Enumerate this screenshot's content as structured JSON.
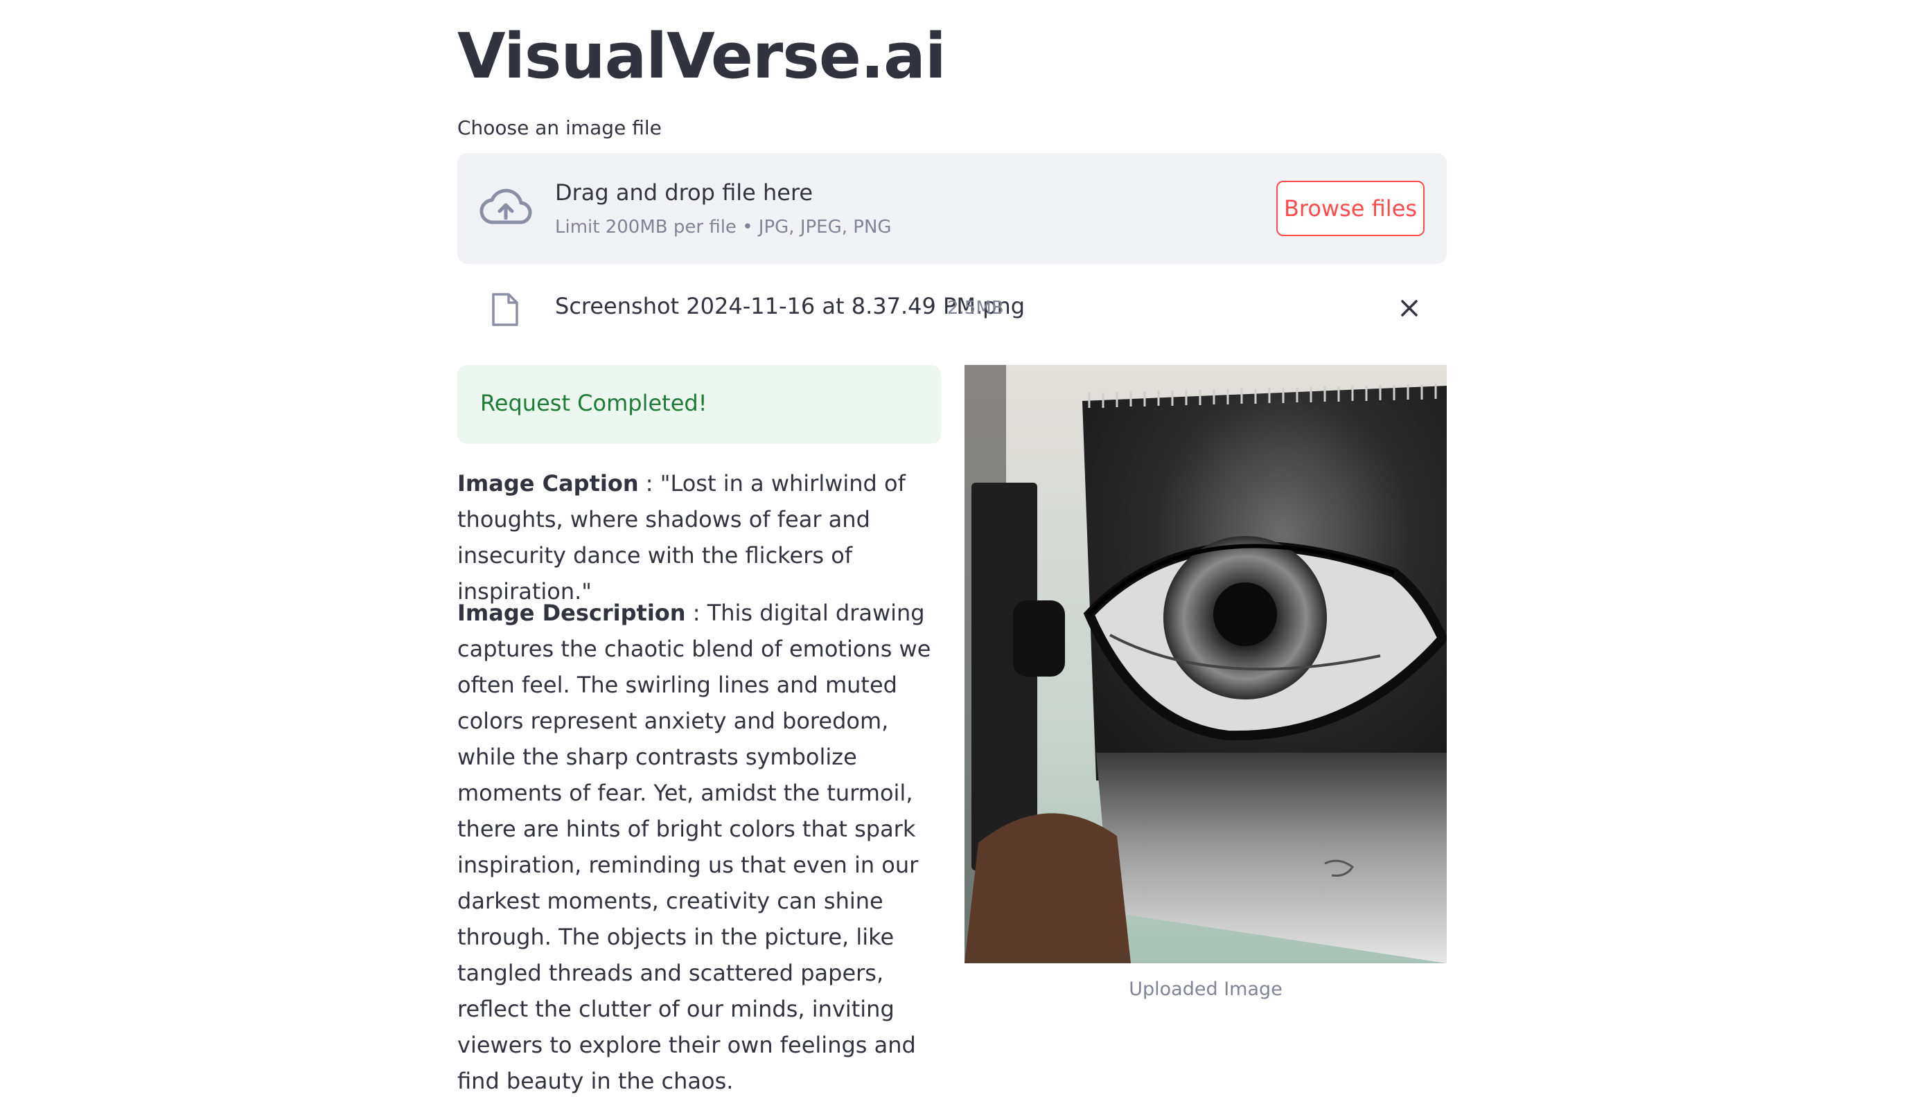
{
  "app": {
    "title": "VisualVerse.ai"
  },
  "uploader": {
    "label": "Choose an image file",
    "drop_title": "Drag and drop file here",
    "drop_limit": "Limit 200MB per file • JPG, JPEG, PNG",
    "browse_label": "Browse files",
    "cloud_icon": "cloud-upload-icon"
  },
  "uploaded_file": {
    "name": "Screenshot 2024-11-16 at 8.37.49 PM.png",
    "size": "2.5MB",
    "file_icon": "file-icon",
    "remove_icon": "close-icon"
  },
  "status": {
    "message": "Request Completed!",
    "color": "#1e7a37",
    "background": "#ecf8ef"
  },
  "result": {
    "caption_label": "Image Caption",
    "caption_text": " : \"Lost in a whirlwind of thoughts, where shadows of fear and insecurity dance with the flickers of inspiration.\"",
    "description_label": "Image Description",
    "description_text": " : This digital drawing captures the chaotic blend of emotions we often feel. The swirling lines and muted colors represent anxiety and boredom, while the sharp contrasts symbolize moments of fear. Yet, amidst the turmoil, there are hints of bright colors that spark inspiration, reminding us that even in our darkest moments, creativity can shine through. The objects in the picture, like tangled threads and scattered papers, reflect the clutter of our minds, inviting viewers to explore their own feelings and find beauty in the chaos."
  },
  "image_panel": {
    "caption": "Uploaded Image"
  },
  "colors": {
    "accent": "#ff4b4b",
    "text": "#31333f",
    "muted": "#808495",
    "dropzone_bg": "#f0f2f6"
  }
}
